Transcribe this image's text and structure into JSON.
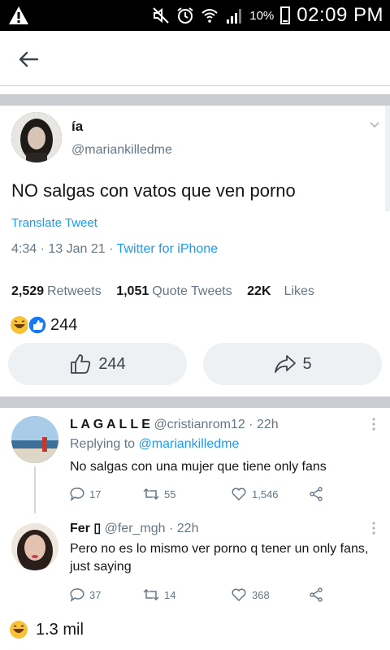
{
  "status_bar": {
    "battery_percent": "10%",
    "time": "02:09 PM",
    "icons": [
      "warning-icon",
      "mute-icon",
      "alarm-icon",
      "wifi-icon",
      "signal-icon",
      "battery-icon"
    ]
  },
  "header": {
    "back_icon": "arrow-left-icon"
  },
  "tweet": {
    "name": "ía",
    "handle": "@mariankilledme",
    "text": "NO salgas con vatos que ven porno",
    "translate_label": "Translate Tweet",
    "time_date": "4:34 · 13 Jan 21 · ",
    "source": "Twitter for iPhone",
    "retweets_count": "2,529",
    "retweets_label": "Retweets",
    "quotes_count": "1,051",
    "quotes_label": "Quote Tweets",
    "likes_count": "22K",
    "likes_label": "Likes",
    "reaction_count": "244",
    "like_button_count": "244",
    "share_button_count": "5"
  },
  "replies": [
    {
      "name": "L A G A L L E",
      "handle": "@cristianrom12",
      "time": " · 22h",
      "replying_prefix": "Replying to ",
      "replying_to": "@mariankilledme",
      "text": "No salgas con una mujer que tiene only fans",
      "replies": "17",
      "retweets": "55",
      "likes": "1,546"
    },
    {
      "name": "Fer ▯",
      "handle": "@fer_mgh",
      "time": " · 22h",
      "text": "Pero no es lo mismo ver porno q tener un only fans, just saying",
      "replies": "37",
      "retweets": "14",
      "likes": "368"
    }
  ],
  "footer": {
    "reaction_count": "1.3 mil"
  },
  "colors": {
    "accent": "#1d9bf0",
    "secondary_text": "#657786",
    "divider": "#c9cdd1"
  }
}
